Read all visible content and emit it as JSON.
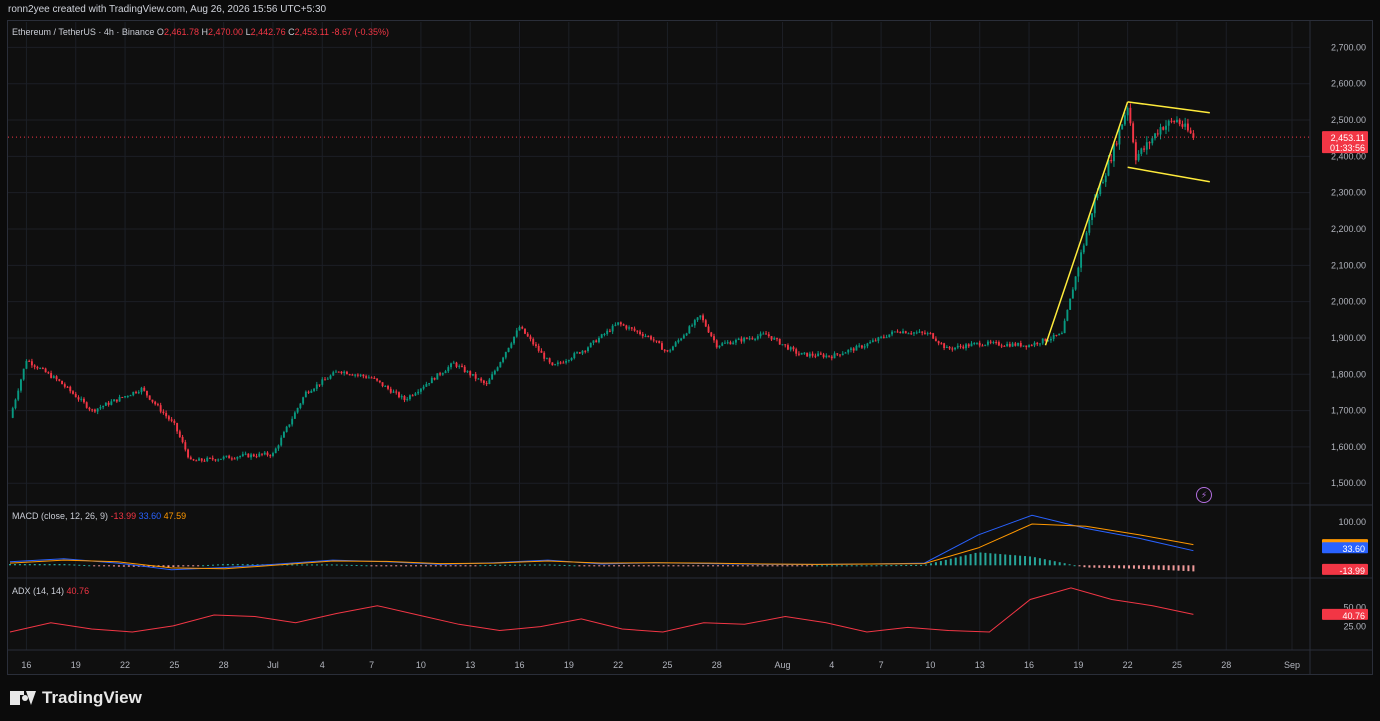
{
  "header": {
    "caption": "ronn2yee created with TradingView.com, Aug 26, 2026 15:56 UTC+5:30"
  },
  "main_legend": {
    "symbol": "Ethereum / TetherUS · 4h · Binance",
    "o_label": "O",
    "o": "2,461.78",
    "h_label": "H",
    "h": "2,470.00",
    "l_label": "L",
    "l": "2,442.76",
    "c_label": "C",
    "c": "2,453.11",
    "change": "-8.67 (-0.35%)"
  },
  "macd_legend": {
    "name": "MACD (close, 12, 26, 9)",
    "hist": "-13.99",
    "macd": "33.60",
    "signal": "47.59"
  },
  "adx_legend": {
    "name": "ADX (14, 14)",
    "value": "40.76"
  },
  "price_tag": {
    "price": "2,453.11",
    "countdown": "01:33:56"
  },
  "brand": {
    "logo_text": "TradingView"
  },
  "colors": {
    "up": "#089981",
    "down": "#f23645",
    "macd": "#2962ff",
    "signal": "#ff9800",
    "adx": "#f23645",
    "pattern": "#ffeb3b",
    "grid": "#1c1f26",
    "axis_text": "#b2b5be",
    "bolt": "#b36fe0"
  },
  "icons": {
    "bolt": "bolt-icon",
    "logo": "tradingview-logo-icon"
  },
  "chart_data": [
    {
      "type": "candlestick",
      "title": "Ethereum / TetherUS · 4h · Binance",
      "y_axis_ticks": [
        "1,500.00",
        "1,600.00",
        "1,700.00",
        "1,800.00",
        "1,900.00",
        "2,000.00",
        "2,100.00",
        "2,200.00",
        "2,300.00",
        "2,400.00",
        "2,500.00",
        "2,600.00",
        "2,700.00"
      ],
      "ylim": [
        1440,
        2770
      ],
      "x_axis_ticks": [
        "16",
        "19",
        "22",
        "25",
        "28",
        "Jul",
        "4",
        "7",
        "10",
        "13",
        "16",
        "19",
        "22",
        "25",
        "28",
        "Aug",
        "4",
        "7",
        "10",
        "13",
        "16",
        "19",
        "22",
        "25",
        "28",
        "Sep"
      ],
      "key_points_close": [
        {
          "date": "Jun 15",
          "close": 1680
        },
        {
          "date": "Jun 16",
          "close": 1840
        },
        {
          "date": "Jun 18",
          "close": 1780
        },
        {
          "date": "Jun 20",
          "close": 1700
        },
        {
          "date": "Jun 23",
          "close": 1760
        },
        {
          "date": "Jun 25",
          "close": 1660
        },
        {
          "date": "Jun 26",
          "close": 1560
        },
        {
          "date": "Jun 29",
          "close": 1575
        },
        {
          "date": "Jul 1",
          "close": 1580
        },
        {
          "date": "Jul 3",
          "close": 1750
        },
        {
          "date": "Jul 5",
          "close": 1810
        },
        {
          "date": "Jul 7",
          "close": 1790
        },
        {
          "date": "Jul 9",
          "close": 1730
        },
        {
          "date": "Jul 12",
          "close": 1830
        },
        {
          "date": "Jul 14",
          "close": 1770
        },
        {
          "date": "Jul 16",
          "close": 1930
        },
        {
          "date": "Jul 18",
          "close": 1820
        },
        {
          "date": "Jul 20",
          "close": 1870
        },
        {
          "date": "Jul 22",
          "close": 1940
        },
        {
          "date": "Jul 24",
          "close": 1900
        },
        {
          "date": "Jul 25",
          "close": 1860
        },
        {
          "date": "Jul 27",
          "close": 1960
        },
        {
          "date": "Jul 28",
          "close": 1880
        },
        {
          "date": "Jul 31",
          "close": 1910
        },
        {
          "date": "Aug 2",
          "close": 1855
        },
        {
          "date": "Aug 4",
          "close": 1850
        },
        {
          "date": "Aug 6",
          "close": 1880
        },
        {
          "date": "Aug 8",
          "close": 1920
        },
        {
          "date": "Aug 10",
          "close": 1910
        },
        {
          "date": "Aug 11",
          "close": 1870
        },
        {
          "date": "Aug 13",
          "close": 1885
        },
        {
          "date": "Aug 16",
          "close": 1880
        },
        {
          "date": "Aug 18",
          "close": 1910
        },
        {
          "date": "Aug 19",
          "close": 2100
        },
        {
          "date": "Aug 20",
          "close": 2280
        },
        {
          "date": "Aug 21",
          "close": 2400
        },
        {
          "date": "Aug 22",
          "close": 2540
        },
        {
          "date": "Aug 22",
          "close": 2400
        },
        {
          "date": "Aug 23",
          "close": 2420
        },
        {
          "date": "Aug 24",
          "close": 2480
        },
        {
          "date": "Aug 25",
          "close": 2500
        },
        {
          "date": "Aug 26",
          "close": 2453.11
        }
      ],
      "drawings": {
        "flagpole": [
          {
            "date": "Aug 17",
            "price": 1880
          },
          {
            "date": "Aug 22",
            "price": 2550
          }
        ],
        "flag_upper": [
          {
            "date": "Aug 22",
            "price": 2550
          },
          {
            "date": "Aug 27",
            "price": 2520
          }
        ],
        "flag_lower": [
          {
            "date": "Aug 22",
            "price": 2370
          },
          {
            "date": "Aug 27",
            "price": 2330
          }
        ]
      },
      "current_price": 2453.11
    },
    {
      "type": "line",
      "title": "MACD (close, 12, 26, 9)",
      "y_axis_ticks": [
        "100.00"
      ],
      "ylim": [
        -20,
        125
      ],
      "series": [
        {
          "name": "MACD",
          "values": [
            8,
            15,
            5,
            -10,
            -5,
            3,
            12,
            8,
            2,
            6,
            12,
            3,
            6,
            4,
            2,
            2,
            3,
            5,
            70,
            115,
            85,
            62,
            33.6
          ]
        },
        {
          "name": "Signal",
          "values": [
            5,
            12,
            8,
            -6,
            -8,
            1,
            10,
            9,
            4,
            5,
            10,
            5,
            6,
            5,
            3,
            2,
            3,
            4,
            40,
            95,
            90,
            70,
            47.59
          ]
        }
      ],
      "current": {
        "macd": 33.6,
        "signal": 47.59,
        "hist": -13.99
      }
    },
    {
      "type": "line",
      "title": "ADX (14, 14)",
      "y_axis_ticks": [
        "25.00",
        "50.00"
      ],
      "ylim": [
        0,
        80
      ],
      "series": [
        {
          "name": "ADX",
          "values": [
            18,
            30,
            22,
            18,
            26,
            40,
            38,
            30,
            42,
            52,
            40,
            28,
            20,
            25,
            35,
            22,
            18,
            30,
            28,
            38,
            30,
            18,
            24,
            20,
            18,
            60,
            75,
            60,
            52,
            40.76
          ]
        }
      ],
      "current": 40.76
    }
  ]
}
